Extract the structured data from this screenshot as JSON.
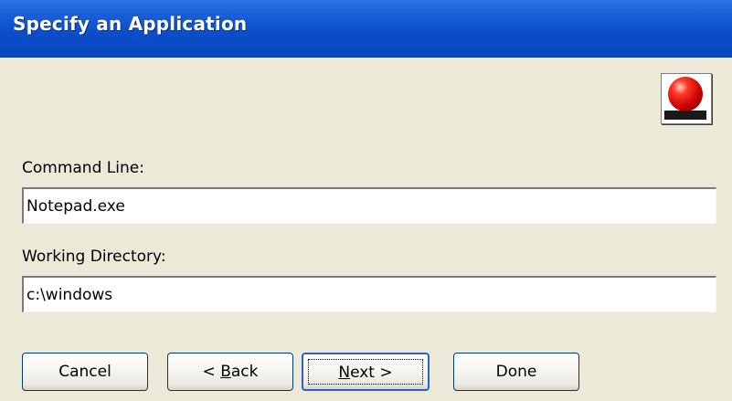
{
  "title": "Specify an Application",
  "icon": "application-icon",
  "command_line": {
    "label": "Command Line:",
    "value": "Notepad.exe"
  },
  "working_directory": {
    "label": "Working Directory:",
    "value": "c:\\windows"
  },
  "buttons": {
    "cancel": "Cancel",
    "back_prefix": "< ",
    "back_mnemonic": "B",
    "back_rest": "ack",
    "next_mnemonic": "N",
    "next_rest": "ext >",
    "done": "Done"
  },
  "colors": {
    "title_bar": "#0b4fcb",
    "background": "#ece9d8",
    "button_border": "#003c74"
  }
}
